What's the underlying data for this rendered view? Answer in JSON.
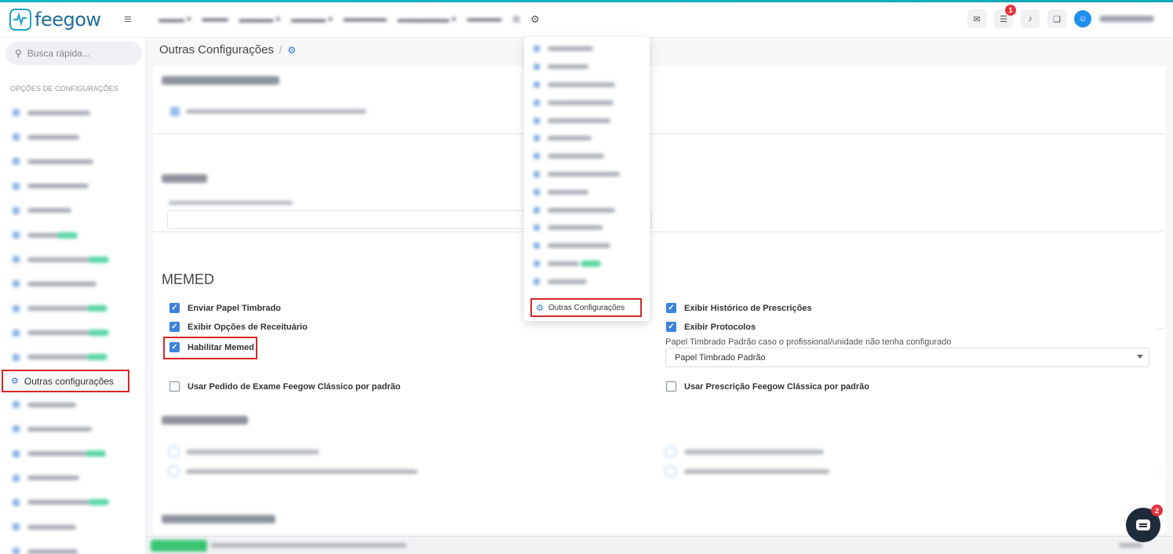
{
  "app": {
    "logo_text": "feegow",
    "hamburger": "≡"
  },
  "topbar": {
    "settings_icon": "gear-icon",
    "notification_badge": "1",
    "user_icon": "user-icon"
  },
  "sidebar": {
    "search_placeholder": "Busca rápida...",
    "section_title": "OPÇÕES DE CONFIGURAÇÕES",
    "active_item": "Outras configurações"
  },
  "breadcrumb": {
    "title": "Outras Configurações",
    "separator": "/"
  },
  "dropdown": {
    "active_item": "Outras Configurações"
  },
  "memed": {
    "heading": "MEMED",
    "left": [
      {
        "label": "Enviar Papel Timbrado",
        "checked": true
      },
      {
        "label": "Exibir Opções de Receituário",
        "checked": true
      },
      {
        "label": "Habilitar Memed",
        "checked": true
      },
      {
        "label": "Usar Pedido de Exame Feegow Clássico por padrão",
        "checked": false
      }
    ],
    "right": [
      {
        "label": "Exibir Histórico de Prescrições",
        "checked": true
      },
      {
        "label": "Exibir Protocolos",
        "checked": true
      },
      {
        "label": "Usar Prescrição Feegow Clássica por padrão",
        "checked": false
      }
    ],
    "select_label": "Papel Timbrado Padrão caso o profissional/unidade não tenha configurado",
    "select_value": "Papel Timbrado Padrão"
  },
  "chat": {
    "badge": "2"
  }
}
